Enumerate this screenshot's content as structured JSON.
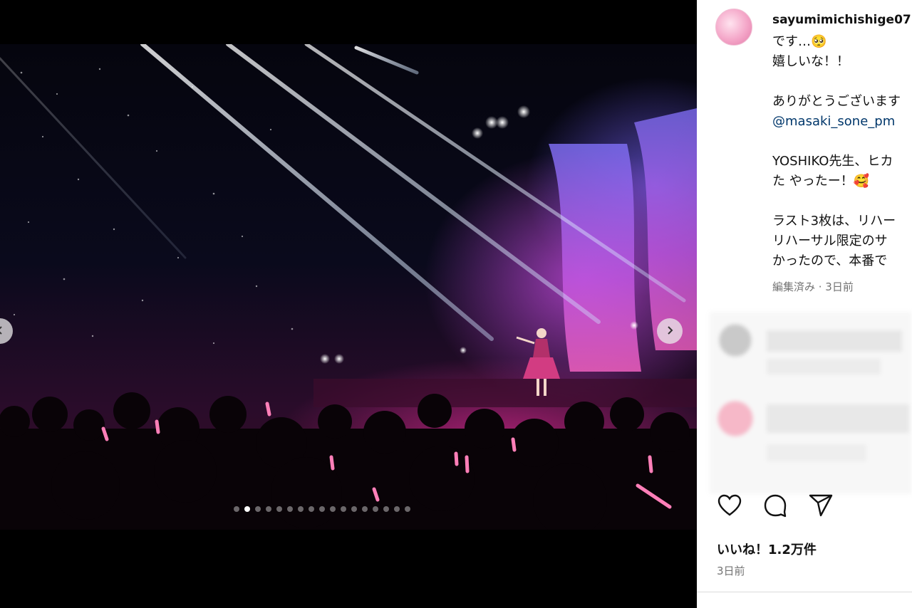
{
  "post": {
    "username": "sayumimichishige07",
    "caption_lines": [
      "です…🥺 ",
      "嬉しいな！！",
      "",
      "ありがとうございます",
      "@masaki_sone_pm",
      "",
      "YOSHIKO先生、ヒカ",
      "た やったー！🥰",
      "",
      "ラスト3枚は、リハー",
      "リハーサル限定のサ",
      "かったので、本番で"
    ],
    "edited_label": "編集済み · 3日前",
    "likes_label": "いいね！1.2万件",
    "date_label": "3日前"
  },
  "carousel": {
    "total_slides": 17,
    "active_index": 1
  },
  "icons": {
    "like": "heart-icon",
    "comment": "comment-icon",
    "share": "share-icon",
    "prev": "chevron-left-icon",
    "next": "chevron-right-icon"
  },
  "colors": {
    "mention": "#00376b",
    "muted": "#737373",
    "stage_pink": "#d0208a",
    "stage_violet": "#8a5ae0"
  }
}
